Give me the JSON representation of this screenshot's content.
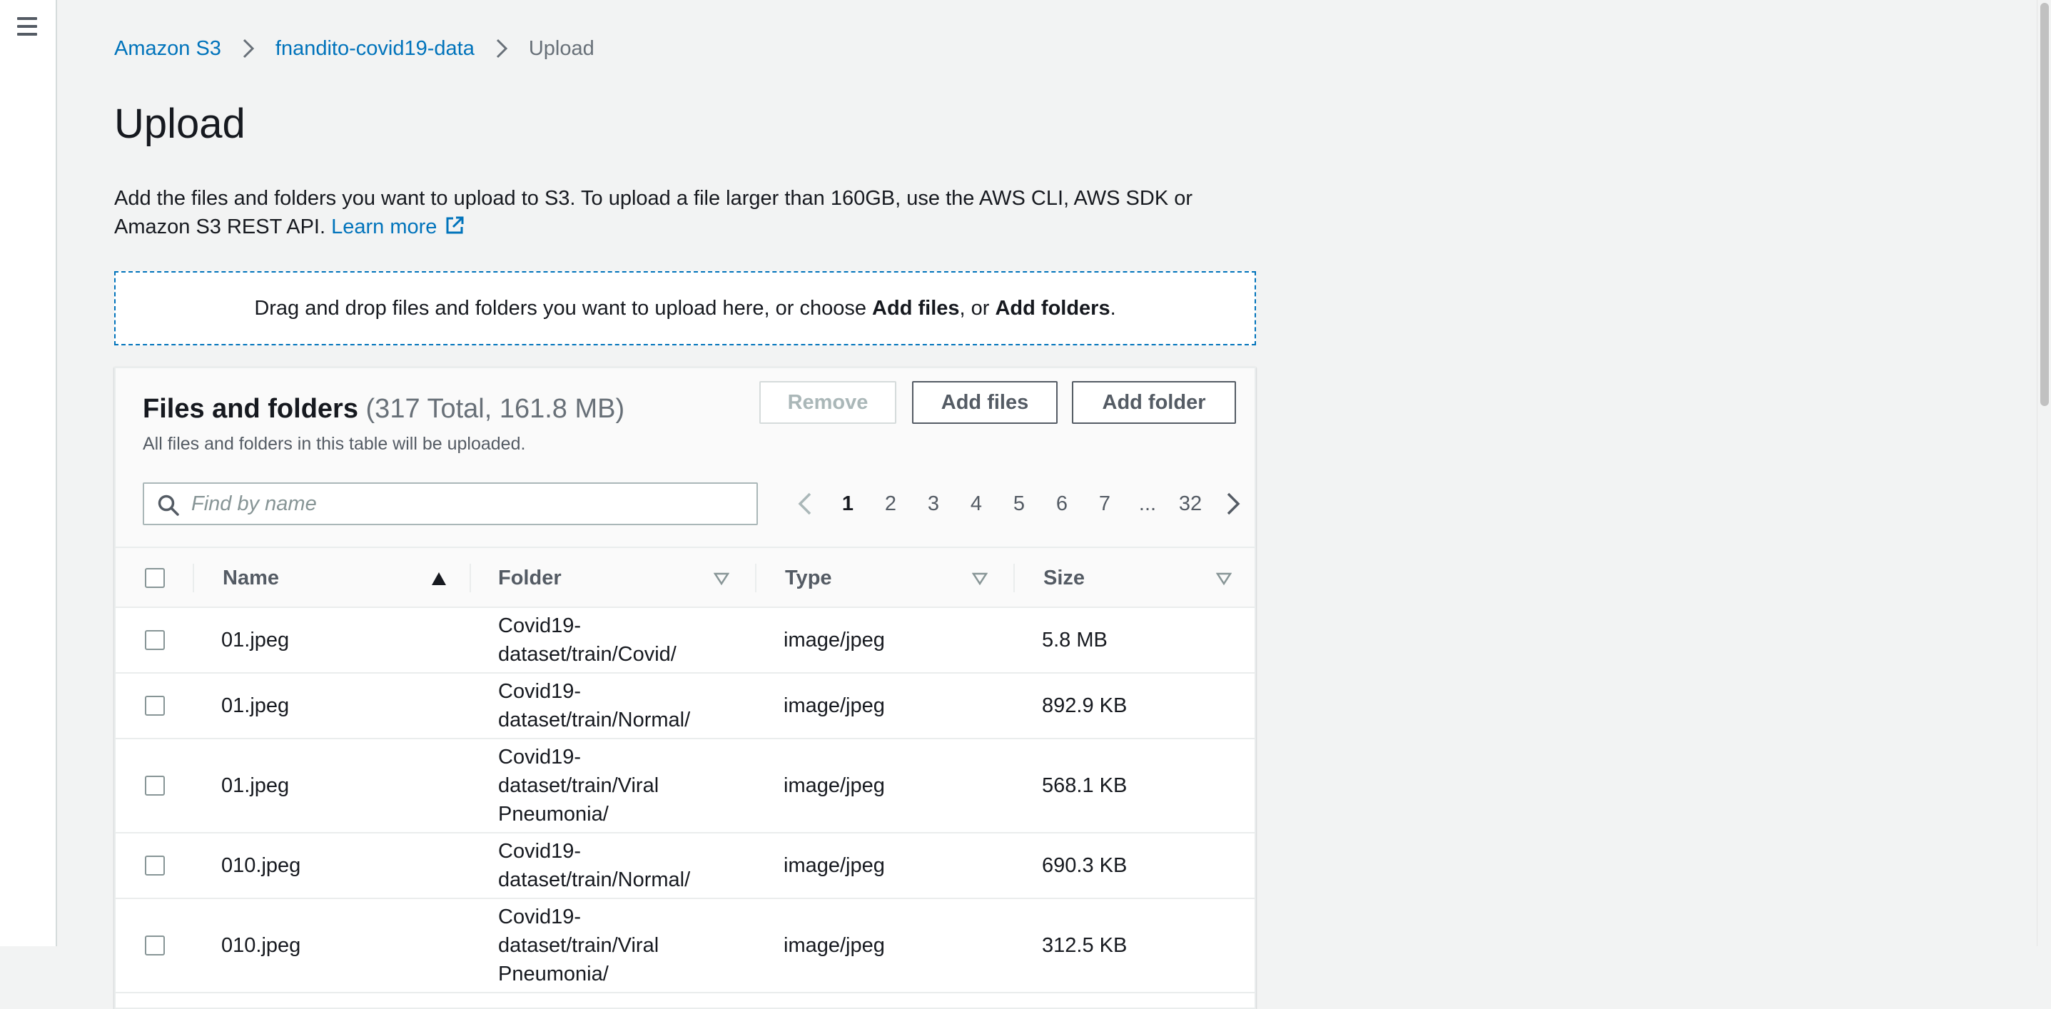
{
  "nav": {
    "menu_icon": "hamburger-menu-icon"
  },
  "breadcrumb": [
    {
      "label": "Amazon S3",
      "link": true
    },
    {
      "label": "fnandito-covid19-data",
      "link": true
    },
    {
      "label": "Upload",
      "link": false
    }
  ],
  "page": {
    "title": "Upload",
    "description": "Add the files and folders you want to upload to S3. To upload a file larger than 160GB, use the AWS CLI, AWS SDK or Amazon S3 REST API.",
    "learn_more": "Learn more"
  },
  "dropzone": {
    "text_prefix": "Drag and drop files and folders you want to upload here, or choose ",
    "add_files": "Add files",
    "text_middle": ", or ",
    "add_folders": "Add folders",
    "text_suffix": "."
  },
  "files_panel": {
    "title": "Files and folders",
    "count": "(317 Total, 161.8 MB)",
    "subtitle": "All files and folders in this table will be uploaded.",
    "buttons": {
      "remove": "Remove",
      "add_files": "Add files",
      "add_folder": "Add folder"
    },
    "search_placeholder": "Find by name",
    "pagination": {
      "pages": [
        "1",
        "2",
        "3",
        "4",
        "5",
        "6",
        "7",
        "...",
        "32"
      ],
      "current": "1"
    },
    "columns": {
      "name": "Name",
      "folder": "Folder",
      "type": "Type",
      "size": "Size"
    },
    "rows": [
      {
        "name": "01.jpeg",
        "folder": "Covid19-\ndataset/train/Covid/",
        "type": "image/jpeg",
        "size": "5.8 MB"
      },
      {
        "name": "01.jpeg",
        "folder": "Covid19-\ndataset/train/Normal/",
        "type": "image/jpeg",
        "size": "892.9 KB"
      },
      {
        "name": "01.jpeg",
        "folder": "Covid19-\ndataset/train/Viral\nPneumonia/",
        "type": "image/jpeg",
        "size": "568.1 KB"
      },
      {
        "name": "010.jpeg",
        "folder": "Covid19-\ndataset/train/Normal/",
        "type": "image/jpeg",
        "size": "690.3 KB"
      },
      {
        "name": "010.jpeg",
        "folder": "Covid19-\ndataset/train/Viral\nPneumonia/",
        "type": "image/jpeg",
        "size": "312.5 KB"
      }
    ]
  }
}
